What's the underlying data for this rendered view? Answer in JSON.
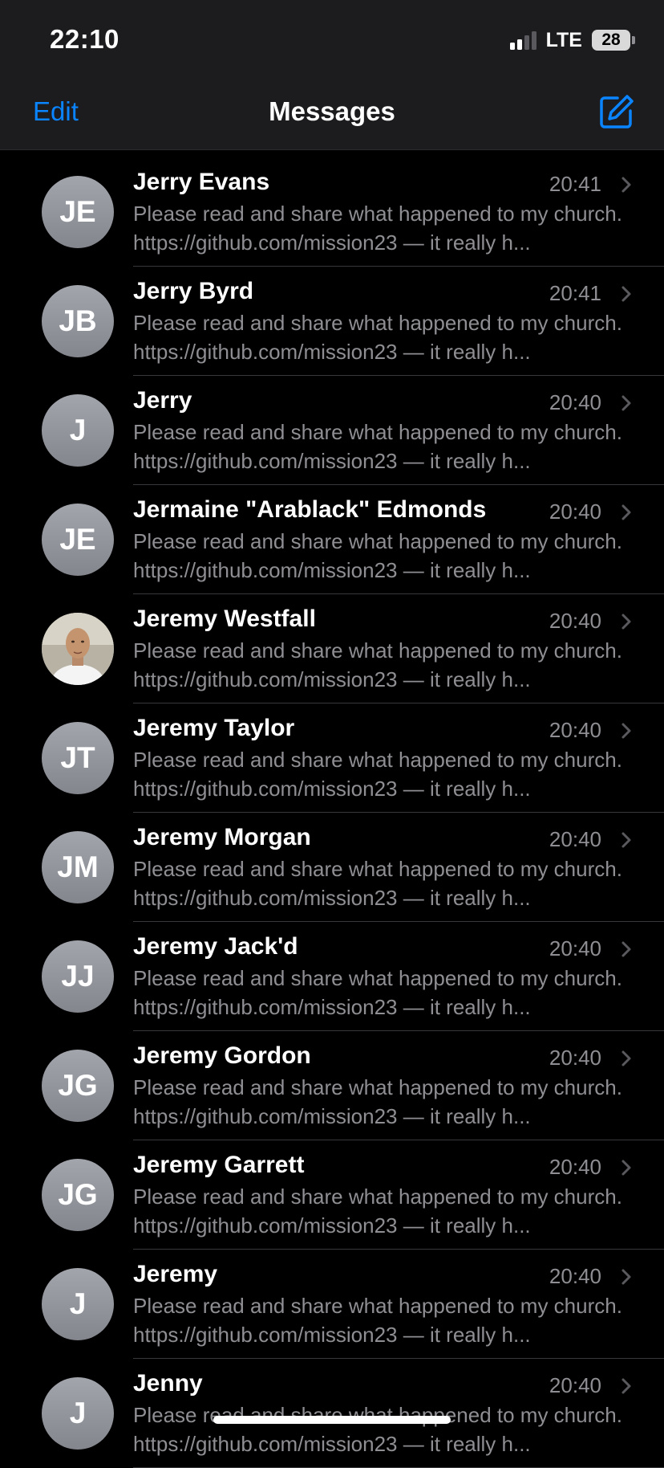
{
  "status_bar": {
    "time": "22:10",
    "network": "LTE",
    "battery": "28"
  },
  "nav": {
    "edit_label": "Edit",
    "title": "Messages",
    "compose_icon": "compose-icon"
  },
  "colors": {
    "accent": "#0a84ff",
    "background": "#000000",
    "header": "#1c1c1e",
    "secondary_text": "#8e8e93",
    "avatar": "#9a9ca4"
  },
  "conversations": [
    {
      "name": "Jerry Evans",
      "initials": "JE",
      "time": "20:41",
      "preview": "Please read and share what happened to my church. https://github.com/mission23 — it really h...",
      "avatar_type": "initials"
    },
    {
      "name": "Jerry Byrd",
      "initials": "JB",
      "time": "20:41",
      "preview": "Please read and share what happened to my church. https://github.com/mission23 — it really h...",
      "avatar_type": "initials"
    },
    {
      "name": "Jerry",
      "initials": "J",
      "time": "20:40",
      "preview": "Please read and share what happened to my church. https://github.com/mission23 — it really h...",
      "avatar_type": "initials"
    },
    {
      "name": "Jermaine \"Arablack\" Edmonds",
      "initials": "JE",
      "time": "20:40",
      "preview": "Please read and share what happened to my church. https://github.com/mission23 — it really h...",
      "avatar_type": "initials"
    },
    {
      "name": "Jeremy Westfall",
      "initials": "",
      "time": "20:40",
      "preview": "Please read and share what happened to my church. https://github.com/mission23 — it really h...",
      "avatar_type": "photo"
    },
    {
      "name": "Jeremy Taylor",
      "initials": "JT",
      "time": "20:40",
      "preview": "Please read and share what happened to my church. https://github.com/mission23 — it really h...",
      "avatar_type": "initials"
    },
    {
      "name": "Jeremy Morgan",
      "initials": "JM",
      "time": "20:40",
      "preview": "Please read and share what happened to my church. https://github.com/mission23 — it really h...",
      "avatar_type": "initials"
    },
    {
      "name": "Jeremy Jack'd",
      "initials": "JJ",
      "time": "20:40",
      "preview": "Please read and share what happened to my church. https://github.com/mission23 — it really h...",
      "avatar_type": "initials"
    },
    {
      "name": "Jeremy Gordon",
      "initials": "JG",
      "time": "20:40",
      "preview": "Please read and share what happened to my church. https://github.com/mission23 — it really h...",
      "avatar_type": "initials"
    },
    {
      "name": "Jeremy Garrett",
      "initials": "JG",
      "time": "20:40",
      "preview": "Please read and share what happened to my church. https://github.com/mission23 — it really h...",
      "avatar_type": "initials"
    },
    {
      "name": "Jeremy",
      "initials": "J",
      "time": "20:40",
      "preview": "Please read and share what happened to my church. https://github.com/mission23 — it really h...",
      "avatar_type": "initials"
    },
    {
      "name": "Jenny",
      "initials": "J",
      "time": "20:40",
      "preview": "Please read and share what happened to my church. https://github.com/mission23 — it really h...",
      "avatar_type": "initials"
    }
  ]
}
